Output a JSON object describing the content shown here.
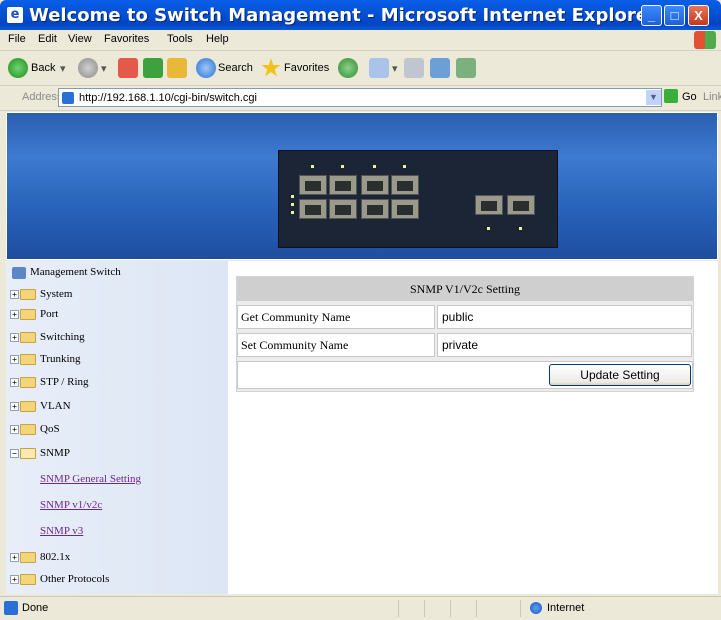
{
  "window": {
    "title": "Welcome to Switch Management - Microsoft Internet Explorer",
    "min_glyph": "_",
    "max_glyph": "□",
    "close_glyph": "X"
  },
  "menu": [
    "File",
    "Edit",
    "View",
    "Favorites",
    "Tools",
    "Help"
  ],
  "toolbar": {
    "back_label": "Back",
    "search_label": "Search",
    "favorites_label": "Favorites"
  },
  "address": {
    "label": "Address",
    "url": "http://192.168.1.10/cgi-bin/switch.cgi",
    "go_label": "Go",
    "links_label": "Links"
  },
  "tree": {
    "root": "Management Switch",
    "items": [
      "System",
      "Port",
      "Switching",
      "Trunking",
      "STP / Ring",
      "VLAN",
      "QoS",
      "SNMP"
    ],
    "snmp_children": [
      "SNMP General Setting",
      "SNMP v1/v2c",
      "SNMP v3"
    ],
    "items_after": [
      "802.1x",
      "Other Protocols"
    ]
  },
  "form": {
    "title": "SNMP V1/V2c Setting",
    "get_label": "Get Community Name",
    "get_value": "public",
    "set_label": "Set Community Name",
    "set_value": "private",
    "update_button": "Update Setting"
  },
  "status": {
    "text": "Done",
    "zone": "Internet"
  },
  "colors": {
    "titlebar": "#0453D6",
    "banner": "#2A5FB0",
    "link_visited": "#6A2A8A",
    "table_header": "#CFCFCF"
  }
}
